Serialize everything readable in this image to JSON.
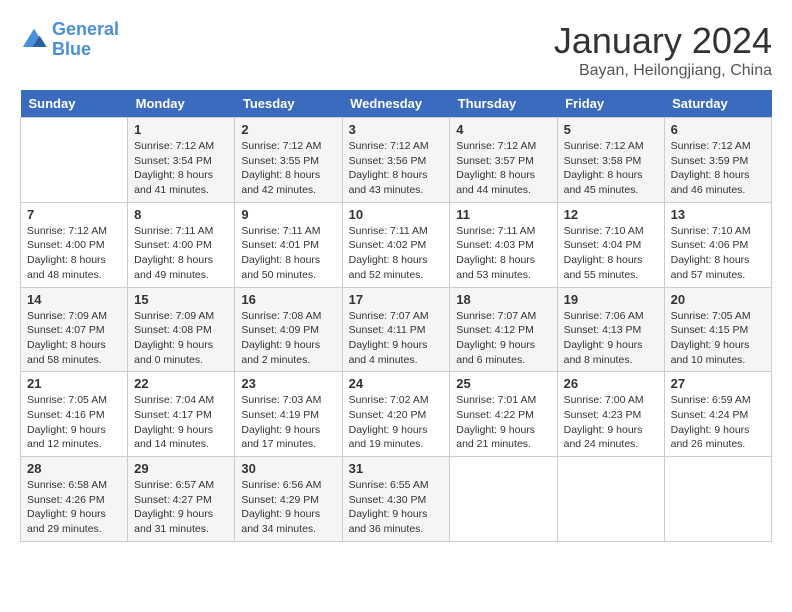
{
  "logo": {
    "line1": "General",
    "line2": "Blue"
  },
  "title": "January 2024",
  "location": "Bayan, Heilongjiang, China",
  "days_of_week": [
    "Sunday",
    "Monday",
    "Tuesday",
    "Wednesday",
    "Thursday",
    "Friday",
    "Saturday"
  ],
  "weeks": [
    [
      {
        "day": "",
        "sunrise": "",
        "sunset": "",
        "daylight": ""
      },
      {
        "day": "1",
        "sunrise": "Sunrise: 7:12 AM",
        "sunset": "Sunset: 3:54 PM",
        "daylight": "Daylight: 8 hours and 41 minutes."
      },
      {
        "day": "2",
        "sunrise": "Sunrise: 7:12 AM",
        "sunset": "Sunset: 3:55 PM",
        "daylight": "Daylight: 8 hours and 42 minutes."
      },
      {
        "day": "3",
        "sunrise": "Sunrise: 7:12 AM",
        "sunset": "Sunset: 3:56 PM",
        "daylight": "Daylight: 8 hours and 43 minutes."
      },
      {
        "day": "4",
        "sunrise": "Sunrise: 7:12 AM",
        "sunset": "Sunset: 3:57 PM",
        "daylight": "Daylight: 8 hours and 44 minutes."
      },
      {
        "day": "5",
        "sunrise": "Sunrise: 7:12 AM",
        "sunset": "Sunset: 3:58 PM",
        "daylight": "Daylight: 8 hours and 45 minutes."
      },
      {
        "day": "6",
        "sunrise": "Sunrise: 7:12 AM",
        "sunset": "Sunset: 3:59 PM",
        "daylight": "Daylight: 8 hours and 46 minutes."
      }
    ],
    [
      {
        "day": "7",
        "sunrise": "",
        "sunset": "",
        "daylight": "Daylight: 8 hours and 48 minutes."
      },
      {
        "day": "8",
        "sunrise": "Sunrise: 7:11 AM",
        "sunset": "Sunset: 4:00 PM",
        "daylight": "Daylight: 8 hours and 49 minutes."
      },
      {
        "day": "9",
        "sunrise": "Sunrise: 7:11 AM",
        "sunset": "Sunset: 4:01 PM",
        "daylight": "Daylight: 8 hours and 50 minutes."
      },
      {
        "day": "10",
        "sunrise": "Sunrise: 7:11 AM",
        "sunset": "Sunset: 4:02 PM",
        "daylight": "Daylight: 8 hours and 52 minutes."
      },
      {
        "day": "11",
        "sunrise": "Sunrise: 7:11 AM",
        "sunset": "Sunset: 4:03 PM",
        "daylight": "Daylight: 8 hours and 53 minutes."
      },
      {
        "day": "12",
        "sunrise": "Sunrise: 7:10 AM",
        "sunset": "Sunset: 4:04 PM",
        "daylight": "Daylight: 8 hours and 55 minutes."
      },
      {
        "day": "13",
        "sunrise": "Sunrise: 7:10 AM",
        "sunset": "Sunset: 4:06 PM",
        "daylight": "Daylight: 8 hours and 57 minutes."
      }
    ],
    [
      {
        "day": "14",
        "sunrise": "",
        "sunset": "",
        "daylight": "Daylight: 8 hours and 58 minutes."
      },
      {
        "day": "15",
        "sunrise": "Sunrise: 7:09 AM",
        "sunset": "Sunset: 4:08 PM",
        "daylight": "Daylight: 9 hours and 0 minutes."
      },
      {
        "day": "16",
        "sunrise": "Sunrise: 7:08 AM",
        "sunset": "Sunset: 4:09 PM",
        "daylight": "Daylight: 9 hours and 2 minutes."
      },
      {
        "day": "17",
        "sunrise": "Sunrise: 7:07 AM",
        "sunset": "Sunset: 4:11 PM",
        "daylight": "Daylight: 9 hours and 4 minutes."
      },
      {
        "day": "18",
        "sunrise": "Sunrise: 7:07 AM",
        "sunset": "Sunset: 4:12 PM",
        "daylight": "Daylight: 9 hours and 6 minutes."
      },
      {
        "day": "19",
        "sunrise": "Sunrise: 7:06 AM",
        "sunset": "Sunset: 4:13 PM",
        "daylight": "Daylight: 9 hours and 8 minutes."
      },
      {
        "day": "20",
        "sunrise": "Sunrise: 7:05 AM",
        "sunset": "Sunset: 4:15 PM",
        "daylight": "Daylight: 9 hours and 10 minutes."
      }
    ],
    [
      {
        "day": "21",
        "sunrise": "Sunrise: 7:05 AM",
        "sunset": "Sunset: 4:16 PM",
        "daylight": "Daylight: 9 hours and 12 minutes."
      },
      {
        "day": "22",
        "sunrise": "Sunrise: 7:04 AM",
        "sunset": "Sunset: 4:17 PM",
        "daylight": "Daylight: 9 hours and 14 minutes."
      },
      {
        "day": "23",
        "sunrise": "Sunrise: 7:03 AM",
        "sunset": "Sunset: 4:19 PM",
        "daylight": "Daylight: 9 hours and 17 minutes."
      },
      {
        "day": "24",
        "sunrise": "Sunrise: 7:02 AM",
        "sunset": "Sunset: 4:20 PM",
        "daylight": "Daylight: 9 hours and 19 minutes."
      },
      {
        "day": "25",
        "sunrise": "Sunrise: 7:01 AM",
        "sunset": "Sunset: 4:22 PM",
        "daylight": "Daylight: 9 hours and 21 minutes."
      },
      {
        "day": "26",
        "sunrise": "Sunrise: 7:00 AM",
        "sunset": "Sunset: 4:23 PM",
        "daylight": "Daylight: 9 hours and 24 minutes."
      },
      {
        "day": "27",
        "sunrise": "Sunrise: 6:59 AM",
        "sunset": "Sunset: 4:24 PM",
        "daylight": "Daylight: 9 hours and 26 minutes."
      }
    ],
    [
      {
        "day": "28",
        "sunrise": "Sunrise: 6:58 AM",
        "sunset": "Sunset: 4:26 PM",
        "daylight": "Daylight: 9 hours and 29 minutes."
      },
      {
        "day": "29",
        "sunrise": "Sunrise: 6:57 AM",
        "sunset": "Sunset: 4:27 PM",
        "daylight": "Daylight: 9 hours and 31 minutes."
      },
      {
        "day": "30",
        "sunrise": "Sunrise: 6:56 AM",
        "sunset": "Sunset: 4:29 PM",
        "daylight": "Daylight: 9 hours and 34 minutes."
      },
      {
        "day": "31",
        "sunrise": "Sunrise: 6:55 AM",
        "sunset": "Sunset: 4:30 PM",
        "daylight": "Daylight: 9 hours and 36 minutes."
      },
      {
        "day": "",
        "sunrise": "",
        "sunset": "",
        "daylight": ""
      },
      {
        "day": "",
        "sunrise": "",
        "sunset": "",
        "daylight": ""
      },
      {
        "day": "",
        "sunrise": "",
        "sunset": "",
        "daylight": ""
      }
    ]
  ],
  "week7_day7_sunrise": "Sunrise: 7:12 AM",
  "week7_day7_sunset": "Sunset: 4:00 PM",
  "week8_day1_sunrise": "Sunrise: 7:11 AM",
  "week8_day1_sunset": "Sunset: 4:00 PM",
  "week9_day1_sunrise": "Sunrise: 7:09 AM",
  "week9_day1_sunset": "Sunset: 4:07 PM",
  "week9_day1_daylight": "Daylight: 8 hours and 58 minutes."
}
